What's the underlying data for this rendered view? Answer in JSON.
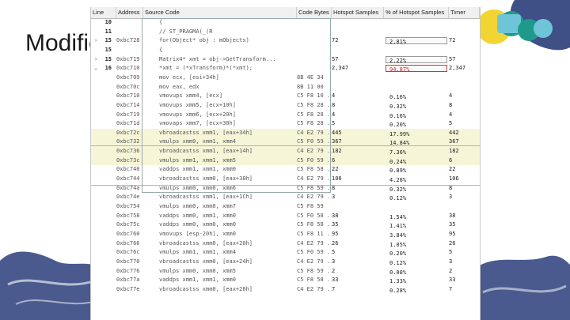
{
  "slide": {
    "title": "Modifie",
    "brand_colors": [
      "#1f9a8a",
      "#6fc5d8",
      "#2a3d7a",
      "#f2d533"
    ]
  },
  "table": {
    "columns": [
      "Line",
      "Address",
      "Source Code",
      "Code Bytes",
      "Hotspot Samples",
      "% of Hotspot Samples",
      "Timer"
    ],
    "rows": [
      {
        "line": "10",
        "exp": "",
        "addr": "",
        "src": "{",
        "bytes": "",
        "hs": "",
        "pct": "",
        "timer": ""
      },
      {
        "line": "11",
        "exp": "",
        "addr": "",
        "src": "//    ST_PRAGMA(_(R",
        "bytes": "",
        "hs": "",
        "pct": "",
        "timer": ""
      },
      {
        "line": "15",
        "exp": "›",
        "addr": "0xbc728",
        "src": "for(Object* obj : mObjects)",
        "bytes": "",
        "hs": "72",
        "pct": "2.81%",
        "timer": "72"
      },
      {
        "line": "15",
        "exp": "",
        "addr": "",
        "src": "{",
        "bytes": "",
        "hs": "",
        "pct": "",
        "timer": ""
      },
      {
        "line": "15",
        "exp": "›",
        "addr": "0xbc719",
        "src": "Matrix4* xmt = obj->GetTransform...",
        "bytes": "",
        "hs": "57",
        "pct": "2.22%",
        "timer": "57"
      },
      {
        "line": "16",
        "exp": "⌄",
        "addr": "0xbc710",
        "src": "*xmt = (*xTransform)*(*xmt);",
        "bytes": "",
        "hs": "2,347",
        "pct": "94.87%",
        "timer": "2,347"
      },
      {
        "line": "",
        "exp": "",
        "addr": "0xbc709",
        "src": "mov ecx, [esi+34h]",
        "bytes": "8B 4E 34",
        "hs": "",
        "pct": "",
        "timer": ""
      },
      {
        "line": "",
        "exp": "",
        "addr": "0xbc70c",
        "src": "mov eax, edx",
        "bytes": "8B 11 00",
        "hs": "",
        "pct": "",
        "timer": ""
      },
      {
        "line": "",
        "exp": "",
        "addr": "0xbc710",
        "src": "vmovups xmm4, [ecx]",
        "bytes": "C5 F8 10 ...",
        "hs": "4",
        "pct": "0.16%",
        "timer": "4"
      },
      {
        "line": "",
        "exp": "",
        "addr": "0xbc714",
        "src": "vmovups xmm5, [ecx+10h]",
        "bytes": "C5 F8 28 ...",
        "hs": "8",
        "pct": "0.32%",
        "timer": "8"
      },
      {
        "line": "",
        "exp": "",
        "addr": "0xbc719",
        "src": "vmovups xmm6, [ecx+20h]",
        "bytes": "C5 F8 28 ...",
        "hs": "4",
        "pct": "0.16%",
        "timer": "4"
      },
      {
        "line": "",
        "exp": "",
        "addr": "0xbc71d",
        "src": "vmovaps xmm7, [ecx+30h]",
        "bytes": "C5 F8 28 ...",
        "hs": "5",
        "pct": "0.20%",
        "timer": "5"
      },
      {
        "line": "",
        "exp": "",
        "addr": "0xbc72c",
        "src": "vbroadcastss xmm1, [eax+34h]",
        "bytes": "C4 E2 79 ...",
        "hs": "445",
        "pct": "17.99%",
        "timer": "442"
      },
      {
        "line": "",
        "exp": "",
        "addr": "0xbc732",
        "src": "vmulps xmm0, xmm1, xmm4",
        "bytes": "C5 F0 59 ...",
        "hs": "367",
        "pct": "14.84%",
        "timer": "367"
      },
      {
        "line": "",
        "exp": "",
        "addr": "0xbc736",
        "src": "vbroadcastss xmm1, [eax+14h]",
        "bytes": "C4 E2 79 ...",
        "hs": "182",
        "pct": "7.36%",
        "timer": "182"
      },
      {
        "line": "",
        "exp": "",
        "addr": "0xbc73c",
        "src": "vmulps xmm1, xmm1, xmm5",
        "bytes": "C5 F0 59 ...",
        "hs": "6",
        "pct": "0.24%",
        "timer": "6"
      },
      {
        "line": "",
        "exp": "",
        "addr": "0xbc740",
        "src": "vaddps xmm1, xmm1, xmm0",
        "bytes": "C5 F8 58 ...",
        "hs": "22",
        "pct": "0.89%",
        "timer": "22"
      },
      {
        "line": "",
        "exp": "",
        "addr": "0xbc744",
        "src": "vbroadcastss xmm0, [eax+38h]",
        "bytes": "C4 E2 79 ...",
        "hs": "106",
        "pct": "4.28%",
        "timer": "106"
      },
      {
        "line": "",
        "exp": "",
        "addr": "0xbc74a",
        "src": "vmulps xmm0, xmm0, xmm6",
        "bytes": "C5 F8 59 ...",
        "hs": "8",
        "pct": "0.32%",
        "timer": "8"
      },
      {
        "line": "",
        "exp": "",
        "addr": "0xbc74e",
        "src": "vbroadcastss xmm1, [eax+1Ch]",
        "bytes": "C4 E2 79 ...",
        "hs": "3",
        "pct": "0.12%",
        "timer": "3"
      },
      {
        "line": "",
        "exp": "",
        "addr": "0xbc754",
        "src": "vmulps xmm0, xmm0, xmm7",
        "bytes": "C5 F8 59",
        "hs": "",
        "pct": "",
        "timer": ""
      },
      {
        "line": "",
        "exp": "",
        "addr": "0xbc758",
        "src": "vaddps xmm0, xmm1, xmm0",
        "bytes": "C5 F0 58 ...",
        "hs": "38",
        "pct": "1.54%",
        "timer": "38"
      },
      {
        "line": "",
        "exp": "",
        "addr": "0xbc75c",
        "src": "vaddps xmm0, xmm0, xmm0",
        "bytes": "C5 F8 58 ...",
        "hs": "35",
        "pct": "1.41%",
        "timer": "35"
      },
      {
        "line": "",
        "exp": "",
        "addr": "0xbc760",
        "src": "vmovups [esp-20h], xmm0",
        "bytes": "C5 F8 11 ...",
        "hs": "95",
        "pct": "3.84%",
        "timer": "95"
      },
      {
        "line": "",
        "exp": "",
        "addr": "0xbc766",
        "src": "vbroadcastss xmm0, [eax+20h]",
        "bytes": "C4 E2 79 ...",
        "hs": "26",
        "pct": "1.05%",
        "timer": "26"
      },
      {
        "line": "",
        "exp": "",
        "addr": "0xbc76c",
        "src": "vmulps xmm1, xmm1, xmm4",
        "bytes": "C5 F0 59 ...",
        "hs": "5",
        "pct": "0.20%",
        "timer": "5"
      },
      {
        "line": "",
        "exp": "",
        "addr": "0xbc770",
        "src": "vbroadcastss xmm0, [eax+24h]",
        "bytes": "C4 E2 79 ...",
        "hs": "3",
        "pct": "0.12%",
        "timer": "3"
      },
      {
        "line": "",
        "exp": "",
        "addr": "0xbc776",
        "src": "vmulps xmm0, xmm0, xmm5",
        "bytes": "C5 F8 59 ...",
        "hs": "2",
        "pct": "0.08%",
        "timer": "2"
      },
      {
        "line": "",
        "exp": "",
        "addr": "0xbc77a",
        "src": "vaddps xmm1, xmm1, xmm0",
        "bytes": "C5 F8 58 ...",
        "hs": "33",
        "pct": "1.33%",
        "timer": "33"
      },
      {
        "line": "",
        "exp": "",
        "addr": "0xbc77e",
        "src": "vbroadcastss xmm0, [eax+28h]",
        "bytes": "C4 E2 79 ...",
        "hs": "7",
        "pct": "0.28%",
        "timer": "7"
      }
    ]
  }
}
